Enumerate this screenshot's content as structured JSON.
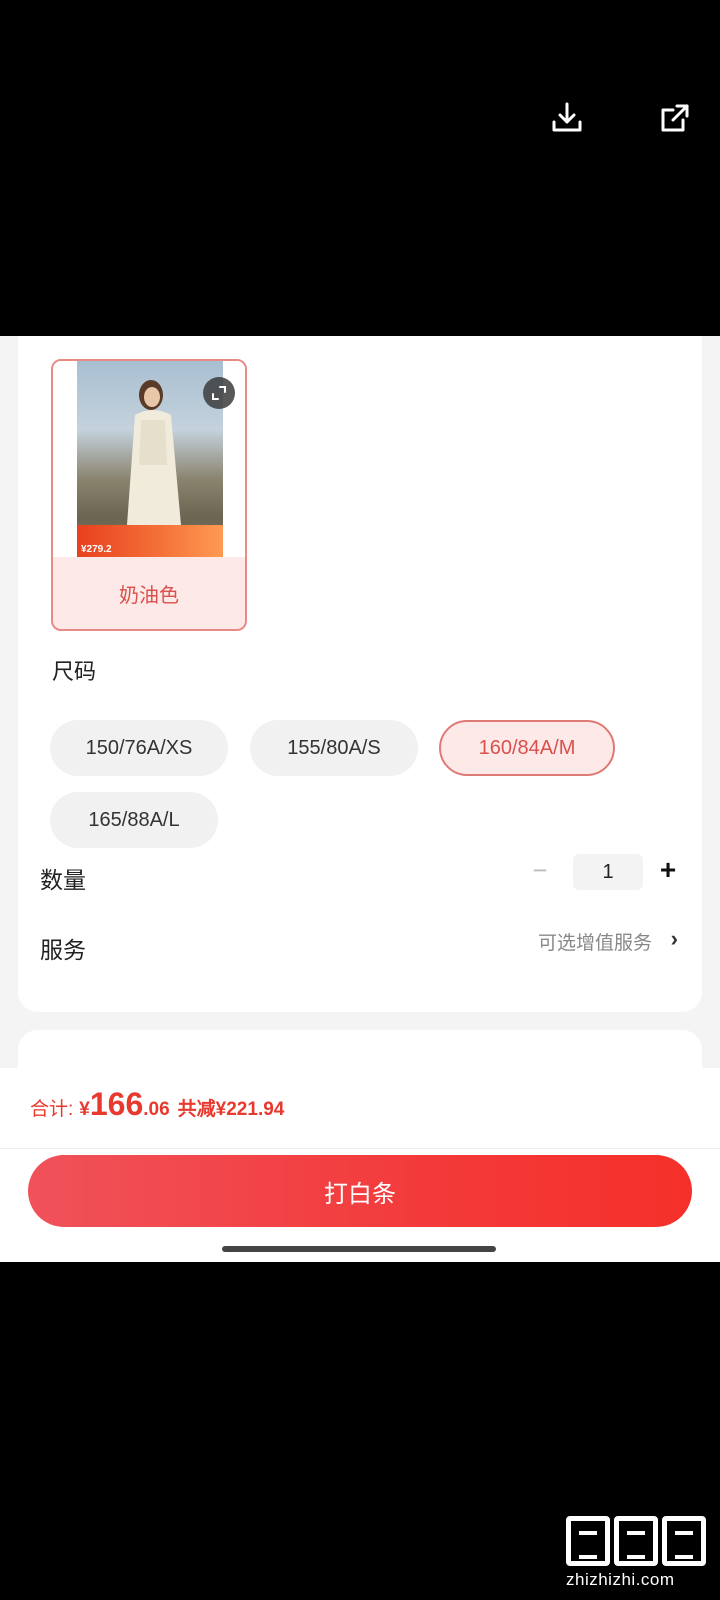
{
  "top_actions": {
    "download_icon": "download-icon",
    "share_icon": "share-icon"
  },
  "color_section": {
    "selected_color": "奶油色",
    "thumbnail_promo_price": "¥279.2"
  },
  "size_section": {
    "title": "尺码",
    "options": [
      "150/76A/XS",
      "155/80A/S",
      "160/84A/M",
      "165/88A/L"
    ],
    "selected": "160/84A/M"
  },
  "quantity": {
    "label": "数量",
    "value": "1",
    "minus": "−",
    "plus": "+"
  },
  "service": {
    "label": "服务",
    "value": "可选增值服务",
    "chevron": "›"
  },
  "summary": {
    "total_label": "合计:",
    "currency": "¥",
    "total_integer": "166",
    "total_decimal": ".06",
    "discount_text": "共减¥221.94"
  },
  "pay_button": {
    "label": "打白条"
  },
  "watermark": {
    "text": "zhizhizhi.com"
  },
  "colors": {
    "accent": "#e8392f",
    "chip_selected_bg": "#fde9e7",
    "chip_selected_border": "#e07a76"
  }
}
